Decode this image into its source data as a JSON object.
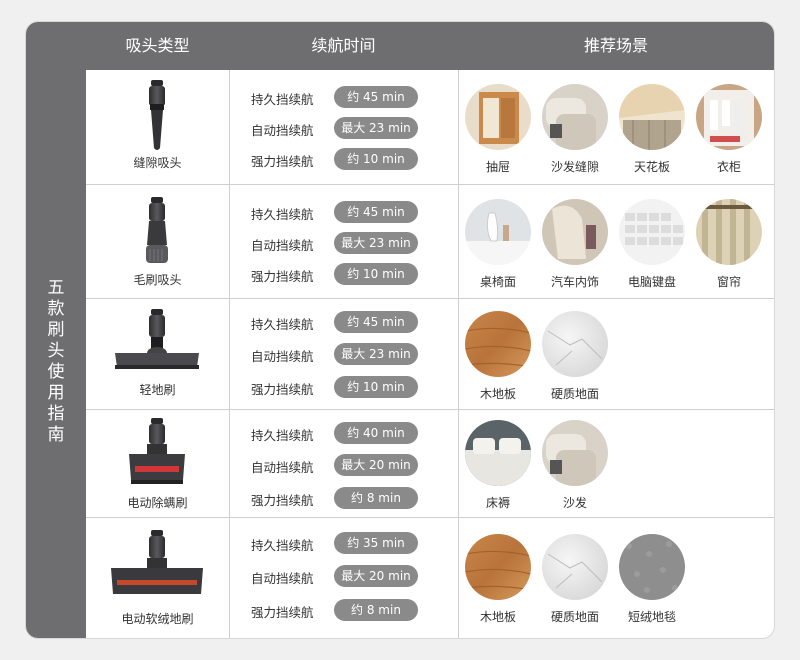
{
  "header": {
    "col_brush": "吸头类型",
    "col_runtime": "续航时间",
    "col_scene": "推荐场景"
  },
  "sidebar": {
    "title_chars": [
      "五",
      "款",
      "刷",
      "头",
      "使",
      "用",
      "指",
      "南"
    ]
  },
  "colors": {
    "header_bg": "#6e6e70",
    "pill_bg": "#8a8a8a",
    "divider": "#cfcfcf"
  },
  "rows": [
    {
      "brush": "缝隙吸头",
      "brush_icon": "crevice-nozzle-icon",
      "modes": [
        {
          "label": "持久挡续航",
          "value": "约 45 min"
        },
        {
          "label": "自动挡续航",
          "value": "最大 23 min"
        },
        {
          "label": "强力挡续航",
          "value": "约 10 min"
        }
      ],
      "scenes": [
        {
          "label": "抽屉",
          "icon": "drawer-photo"
        },
        {
          "label": "沙发缝隙",
          "icon": "sofa-gap-photo"
        },
        {
          "label": "天花板",
          "icon": "ceiling-photo"
        },
        {
          "label": "衣柜",
          "icon": "wardrobe-photo"
        }
      ]
    },
    {
      "brush": "毛刷吸头",
      "brush_icon": "dusting-brush-icon",
      "modes": [
        {
          "label": "持久挡续航",
          "value": "约 45 min"
        },
        {
          "label": "自动挡续航",
          "value": "最大 23 min"
        },
        {
          "label": "强力挡续航",
          "value": "约 10 min"
        }
      ],
      "scenes": [
        {
          "label": "桌椅面",
          "icon": "table-photo"
        },
        {
          "label": "汽车内饰",
          "icon": "car-interior-photo"
        },
        {
          "label": "电脑键盘",
          "icon": "keyboard-photo"
        },
        {
          "label": "窗帘",
          "icon": "curtain-photo"
        }
      ]
    },
    {
      "brush": "轻地刷",
      "brush_icon": "light-floor-brush-icon",
      "modes": [
        {
          "label": "持久挡续航",
          "value": "约 45 min"
        },
        {
          "label": "自动挡续航",
          "value": "最大 23 min"
        },
        {
          "label": "强力挡续航",
          "value": "约 10 min"
        }
      ],
      "scenes": [
        {
          "label": "木地板",
          "icon": "wood-floor-photo"
        },
        {
          "label": "硬质地面",
          "icon": "marble-floor-photo"
        }
      ]
    },
    {
      "brush": "电动除螨刷",
      "brush_icon": "mite-brush-icon",
      "modes": [
        {
          "label": "持久挡续航",
          "value": "约 40 min"
        },
        {
          "label": "自动挡续航",
          "value": "最大 20 min"
        },
        {
          "label": "强力挡续航",
          "value": "约 8 min"
        }
      ],
      "scenes": [
        {
          "label": "床褥",
          "icon": "bed-photo"
        },
        {
          "label": "沙发",
          "icon": "sofa-photo"
        }
      ]
    },
    {
      "brush": "电动软绒地刷",
      "brush_icon": "soft-roller-brush-icon",
      "modes": [
        {
          "label": "持久挡续航",
          "value": "约 35 min"
        },
        {
          "label": "自动挡续航",
          "value": "最大 20 min"
        },
        {
          "label": "强力挡续航",
          "value": "约 8 min"
        }
      ],
      "scenes": [
        {
          "label": "木地板",
          "icon": "wood-floor-photo"
        },
        {
          "label": "硬质地面",
          "icon": "marble-floor-photo"
        },
        {
          "label": "短绒地毯",
          "icon": "carpet-photo"
        }
      ]
    }
  ]
}
